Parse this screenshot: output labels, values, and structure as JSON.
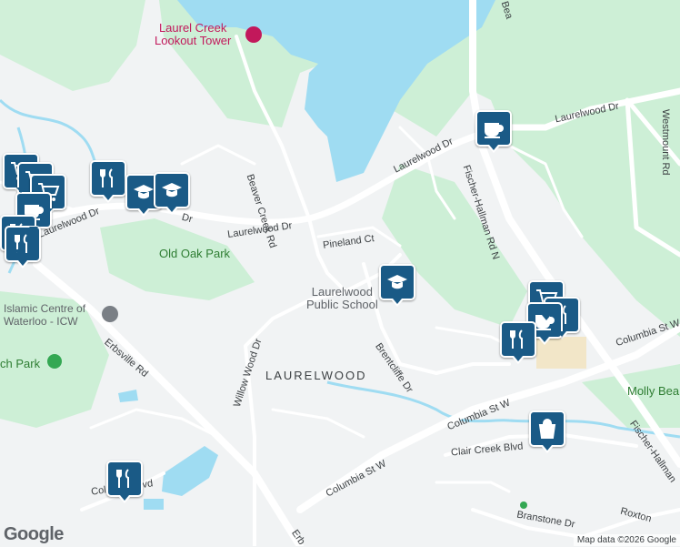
{
  "map": {
    "colors": {
      "land": "#f1f3f4",
      "park": "#cdefd6",
      "water": "#9fdcf2",
      "road": "#ffffff",
      "pin": "#1a5a86"
    },
    "labels": {
      "lookout_tower": "Laurel Creek\nLookout Tower",
      "old_oak_park": "Old Oak Park",
      "islamic_centre": "Islamic Centre of\nWaterloo - ICW",
      "ch_park": "ch Park",
      "laurelwood_school": "Laurelwood\nPublic School",
      "laurelwood_area": "LAURELWOOD",
      "molly_bea": "Molly Bea"
    },
    "roads": {
      "beaver_creek_rd": "Beaver Creek Rd",
      "laurelwood_dr_1": "Laurelwood Dr",
      "laurelwood_dr_2": "Laurelwood Dr",
      "laurelwood_dr_3": "Laurelwood Dr",
      "laurelwood_dr_4": "Laurelwood Dr",
      "laurelwood_dr_5": "rwood Dr",
      "pineland_ct": "Pineland Ct",
      "fischer_hallman_n": "Fischer-Hallman Rd N",
      "fischer_hallman_s": "Fischer-Hallman",
      "westmount_rd": "Westmount Rd",
      "brentcliffe_dr": "Brentcliffe Dr",
      "columbia_st_w_1": "Columbia St W",
      "columbia_st_w_2": "Columbia St W",
      "columbia_st_w_3": "Columbia St W",
      "erbsville_rd": "Erbsville Rd",
      "willow_wood_dr": "Willow Wood Dr",
      "clair_creek_blvd": "Clair Creek Blvd",
      "colonial_crest_blvd": "Colu      rest Blvd",
      "branstone_dr": "Branstone Dr",
      "roxton": "Roxton",
      "erb_bottom": "Erb",
      "bea_top": "Bea",
      "dr_west": "Dr"
    },
    "pins": [
      "restaurant-icon",
      "school-icon",
      "coffee-icon",
      "shopping-cart-icon",
      "shopping-bag-icon"
    ],
    "logo": "Google",
    "attribution": "Map data ©2026 Google"
  }
}
